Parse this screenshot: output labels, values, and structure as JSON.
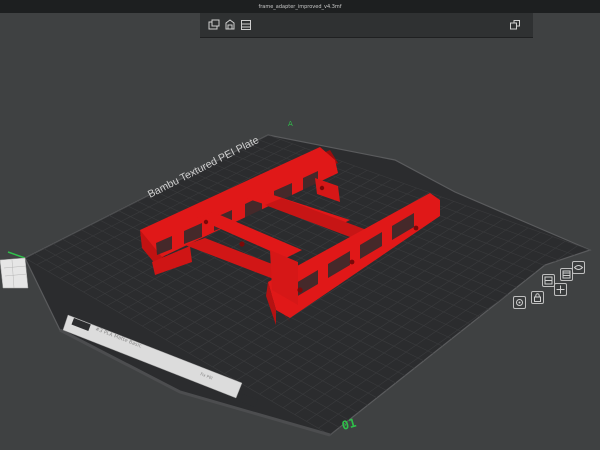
{
  "window": {
    "title": "frame_adapter_improved_v4.3mf"
  },
  "toolbar": {
    "buttons": [
      {
        "name": "add-plate-icon"
      },
      {
        "name": "auto-orient-icon"
      },
      {
        "name": "arrange-icon"
      },
      {
        "name": "split-objects-icon"
      }
    ]
  },
  "plate": {
    "label": "Bambu Textured PEI Plate",
    "plate_number": "01",
    "bed_color": "#2b2c2e",
    "grid_color": "#3a3b3d",
    "edge_color": "#5a5b5d",
    "model_color": "#e01818",
    "model_shadow_color": "#9c0d0d",
    "axis_x_color": "#2fbf4a",
    "axis_y_color": "#d83b3b",
    "plate_tag_text": "#3 PLA Matte Basic",
    "plate_tag_side": "Fix PEI"
  },
  "plate_controls": [
    {
      "name": "plate-settings-icon"
    },
    {
      "name": "plate-lock-icon"
    },
    {
      "name": "plate-arrange-icon"
    },
    {
      "name": "plate-orient-icon"
    },
    {
      "name": "plate-move-icon"
    },
    {
      "name": "plate-view-icon"
    }
  ]
}
